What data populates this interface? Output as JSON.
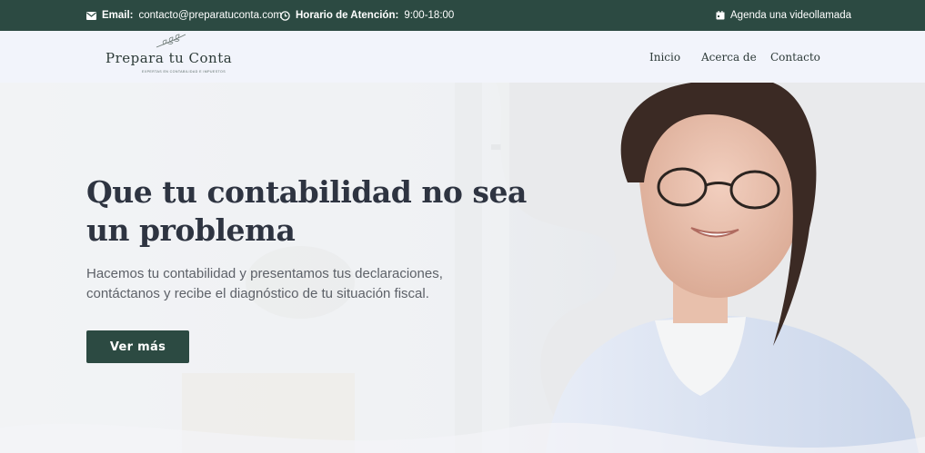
{
  "topbar": {
    "email_label": "Email:",
    "email_value": "contacto@preparatuconta.com",
    "hours_label": "Horario de Atención:",
    "hours_value": "9:00-18:00",
    "video_call": "Agenda una videollamada"
  },
  "header": {
    "logo_main": "Prepara tu Conta",
    "logo_sub": "EXPERTAS EN CONTABILIDAD E IMPUESTOS",
    "nav": [
      "Inicio",
      "Acerca de",
      "Contacto"
    ]
  },
  "hero": {
    "title": "Que tu contabilidad no sea un problema",
    "text": "Hacemos tu contabilidad y presentamos tus declaraciones, contáctanos y recibe el diagnóstico de tu situación fiscal.",
    "cta": "Ver más"
  },
  "colors": {
    "brand": "#2c4a42",
    "heading": "#2e3441",
    "body_text": "#5d6168"
  },
  "icons": [
    "envelope-icon",
    "clock-icon",
    "calendar-icon",
    "leaf-icon"
  ]
}
